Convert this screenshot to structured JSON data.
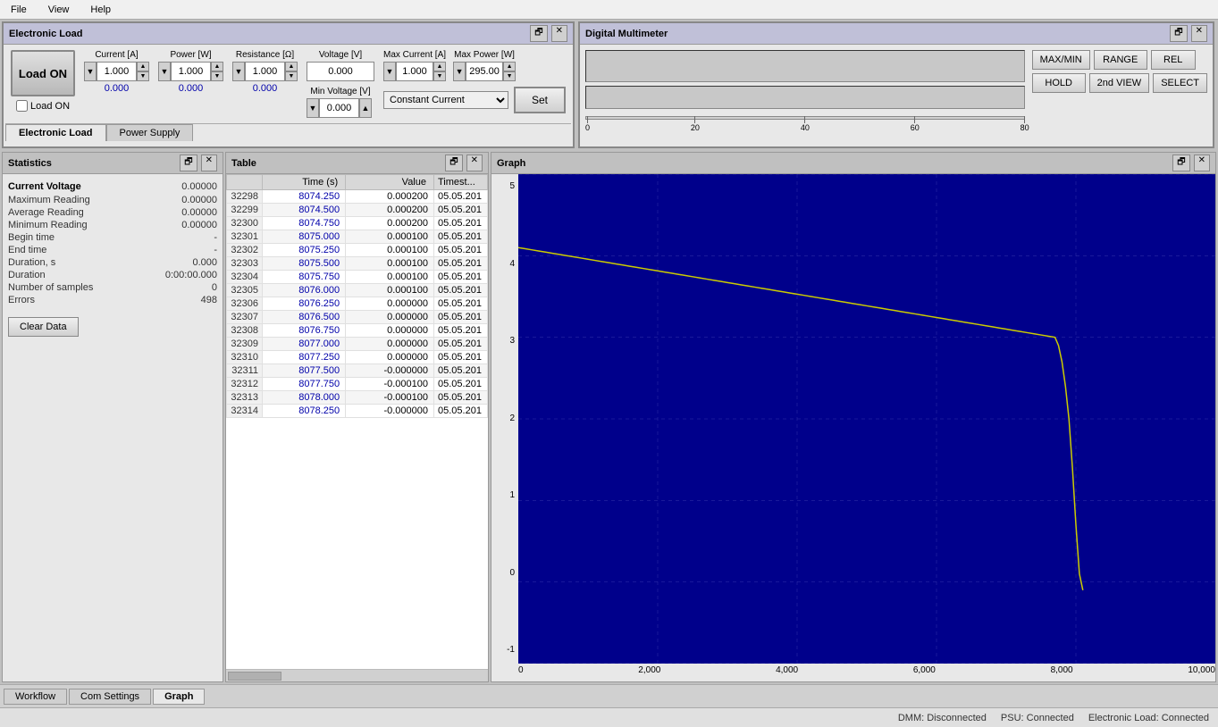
{
  "menubar": {
    "items": [
      "File",
      "View",
      "Help"
    ]
  },
  "el_panel": {
    "title": "Electronic Load",
    "controls": {
      "load_on_btn": "Load ON",
      "load_on_checkbox": "Load ON",
      "current_label": "Current [A]",
      "current_value": "1.000",
      "current_reading": "0.000",
      "power_label": "Power [W]",
      "power_value": "1.000",
      "power_reading": "0.000",
      "resistance_label": "Resistance [Ω]",
      "resistance_value": "1.000",
      "resistance_reading": "0.000",
      "voltage_label": "Voltage [V]",
      "voltage_value": "0.000",
      "min_voltage_label": "Min Voltage [V]",
      "min_voltage_value": "0.000",
      "max_current_label": "Max Current [A]",
      "max_current_value": "1.000",
      "max_power_label": "Max Power [W]",
      "max_power_value": "295.00",
      "mode_label": "Constant Current",
      "set_btn": "Set"
    },
    "tabs": [
      "Electronic Load",
      "Power Supply"
    ]
  },
  "dmm_panel": {
    "title": "Digital Multimeter",
    "buttons_row1": [
      "MAX/MIN",
      "RANGE",
      "REL"
    ],
    "buttons_row2": [
      "HOLD",
      "2nd VIEW",
      "SELECT"
    ],
    "scale_ticks": [
      "0",
      "20",
      "40",
      "60",
      "80"
    ]
  },
  "statistics": {
    "title": "Statistics",
    "rows": [
      {
        "label": "Current Voltage",
        "value": "0.00000",
        "bold": true
      },
      {
        "label": "Maximum Reading",
        "value": "0.00000"
      },
      {
        "label": "Average Reading",
        "value": "0.00000"
      },
      {
        "label": "Minimum Reading",
        "value": "0.00000"
      },
      {
        "label": "Begin time",
        "value": "-"
      },
      {
        "label": "End time",
        "value": "-"
      },
      {
        "label": "Duration, s",
        "value": "0.000"
      },
      {
        "label": "Duration",
        "value": "0:00:00.000"
      },
      {
        "label": "Number of samples",
        "value": "0"
      },
      {
        "label": "Errors",
        "value": "498"
      }
    ],
    "clear_btn": "Clear Data"
  },
  "table": {
    "title": "Table",
    "columns": [
      "Time (s)",
      "Value",
      "Timest..."
    ],
    "rows": [
      {
        "id": "32298",
        "time": "8074.250",
        "value": "0.000200",
        "timestamp": "05.05.201"
      },
      {
        "id": "32299",
        "time": "8074.500",
        "value": "0.000200",
        "timestamp": "05.05.201"
      },
      {
        "id": "32300",
        "time": "8074.750",
        "value": "0.000200",
        "timestamp": "05.05.201"
      },
      {
        "id": "32301",
        "time": "8075.000",
        "value": "0.000100",
        "timestamp": "05.05.201"
      },
      {
        "id": "32302",
        "time": "8075.250",
        "value": "0.000100",
        "timestamp": "05.05.201"
      },
      {
        "id": "32303",
        "time": "8075.500",
        "value": "0.000100",
        "timestamp": "05.05.201"
      },
      {
        "id": "32304",
        "time": "8075.750",
        "value": "0.000100",
        "timestamp": "05.05.201"
      },
      {
        "id": "32305",
        "time": "8076.000",
        "value": "0.000100",
        "timestamp": "05.05.201"
      },
      {
        "id": "32306",
        "time": "8076.250",
        "value": "0.000000",
        "timestamp": "05.05.201"
      },
      {
        "id": "32307",
        "time": "8076.500",
        "value": "0.000000",
        "timestamp": "05.05.201"
      },
      {
        "id": "32308",
        "time": "8076.750",
        "value": "0.000000",
        "timestamp": "05.05.201"
      },
      {
        "id": "32309",
        "time": "8077.000",
        "value": "0.000000",
        "timestamp": "05.05.201"
      },
      {
        "id": "32310",
        "time": "8077.250",
        "value": "0.000000",
        "timestamp": "05.05.201"
      },
      {
        "id": "32311",
        "time": "8077.500",
        "value": "-0.000000",
        "timestamp": "05.05.201"
      },
      {
        "id": "32312",
        "time": "8077.750",
        "value": "-0.000100",
        "timestamp": "05.05.201"
      },
      {
        "id": "32313",
        "time": "8078.000",
        "value": "-0.000100",
        "timestamp": "05.05.201"
      },
      {
        "id": "32314",
        "time": "8078.250",
        "value": "-0.000000",
        "timestamp": "05.05.201"
      }
    ]
  },
  "graph": {
    "title": "Graph",
    "x_labels": [
      "0",
      "2,000",
      "4,000",
      "6,000",
      "8,000",
      "10,000"
    ],
    "y_labels": [
      "-1",
      "0",
      "1",
      "2",
      "3",
      "4",
      "5"
    ],
    "bg_color": "#00008b"
  },
  "bottom_tabs": {
    "items": [
      "Workflow",
      "Com Settings",
      "Graph"
    ],
    "active": "Graph"
  },
  "statusbar": {
    "dmm": "DMM: Disconnected",
    "psu": "PSU: Connected",
    "el": "Electronic Load: Connected"
  }
}
